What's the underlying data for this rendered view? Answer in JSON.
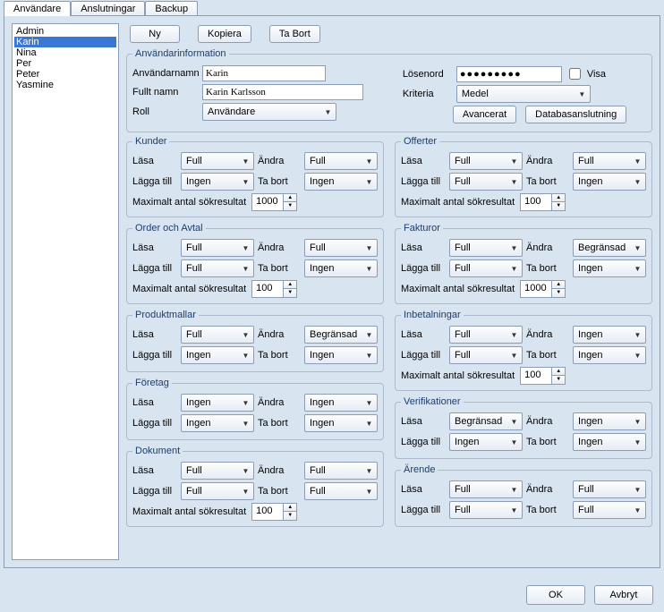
{
  "tabs": [
    "Användare",
    "Anslutningar",
    "Backup"
  ],
  "activeTab": 0,
  "users": [
    "Admin",
    "Karin",
    "Nina",
    "Per",
    "Peter",
    "Yasmine"
  ],
  "selectedUser": "Karin",
  "buttons": {
    "ny": "Ny",
    "kopiera": "Kopiera",
    "tabort": "Ta Bort",
    "ok": "OK",
    "avbryt": "Avbryt",
    "avancerat": "Avancerat",
    "databas": "Databasanslutning"
  },
  "userinfo": {
    "legend": "Användarinformation",
    "labels": {
      "username": "Användarnamn",
      "fullname": "Fullt namn",
      "role": "Roll",
      "password": "Lösenord",
      "criteria": "Kriteria",
      "show": "Visa"
    },
    "values": {
      "username": "Karin",
      "fullname": "Karin Karlsson",
      "role": "Användare",
      "password": "●●●●●●●●●",
      "criteria": "Medel"
    }
  },
  "permLabels": {
    "read": "Läsa",
    "edit": "Ändra",
    "add": "Lägga till",
    "del": "Ta bort",
    "max": "Maximalt antal sökresultat"
  },
  "sections": {
    "kunder": {
      "title": "Kunder",
      "read": "Full",
      "edit": "Full",
      "add": "Ingen",
      "del": "Ingen",
      "max": "1000"
    },
    "offerter": {
      "title": "Offerter",
      "read": "Full",
      "edit": "Full",
      "add": "Full",
      "del": "Ingen",
      "max": "100"
    },
    "order": {
      "title": "Order och Avtal",
      "read": "Full",
      "edit": "Full",
      "add": "Full",
      "del": "Ingen",
      "max": "100"
    },
    "fakturor": {
      "title": "Fakturor",
      "read": "Full",
      "edit": "Begränsad",
      "add": "Full",
      "del": "Ingen",
      "max": "1000"
    },
    "produktmallar": {
      "title": "Produktmallar",
      "read": "Full",
      "edit": "Begränsad",
      "add": "Ingen",
      "del": "Ingen"
    },
    "inbetalningar": {
      "title": "Inbetalningar",
      "read": "Full",
      "edit": "Ingen",
      "add": "Full",
      "del": "Ingen",
      "max": "100"
    },
    "foretag": {
      "title": "Företag",
      "read": "Ingen",
      "edit": "Ingen",
      "add": "Ingen",
      "del": "Ingen"
    },
    "verifikationer": {
      "title": "Verifikationer",
      "read": "Begränsad",
      "edit": "Ingen",
      "add": "Ingen",
      "del": "Ingen"
    },
    "dokument": {
      "title": "Dokument",
      "read": "Full",
      "edit": "Full",
      "add": "Full",
      "del": "Full",
      "max": "100"
    },
    "arende": {
      "title": "Ärende",
      "read": "Full",
      "edit": "Full",
      "add": "Full",
      "del": "Full"
    }
  }
}
